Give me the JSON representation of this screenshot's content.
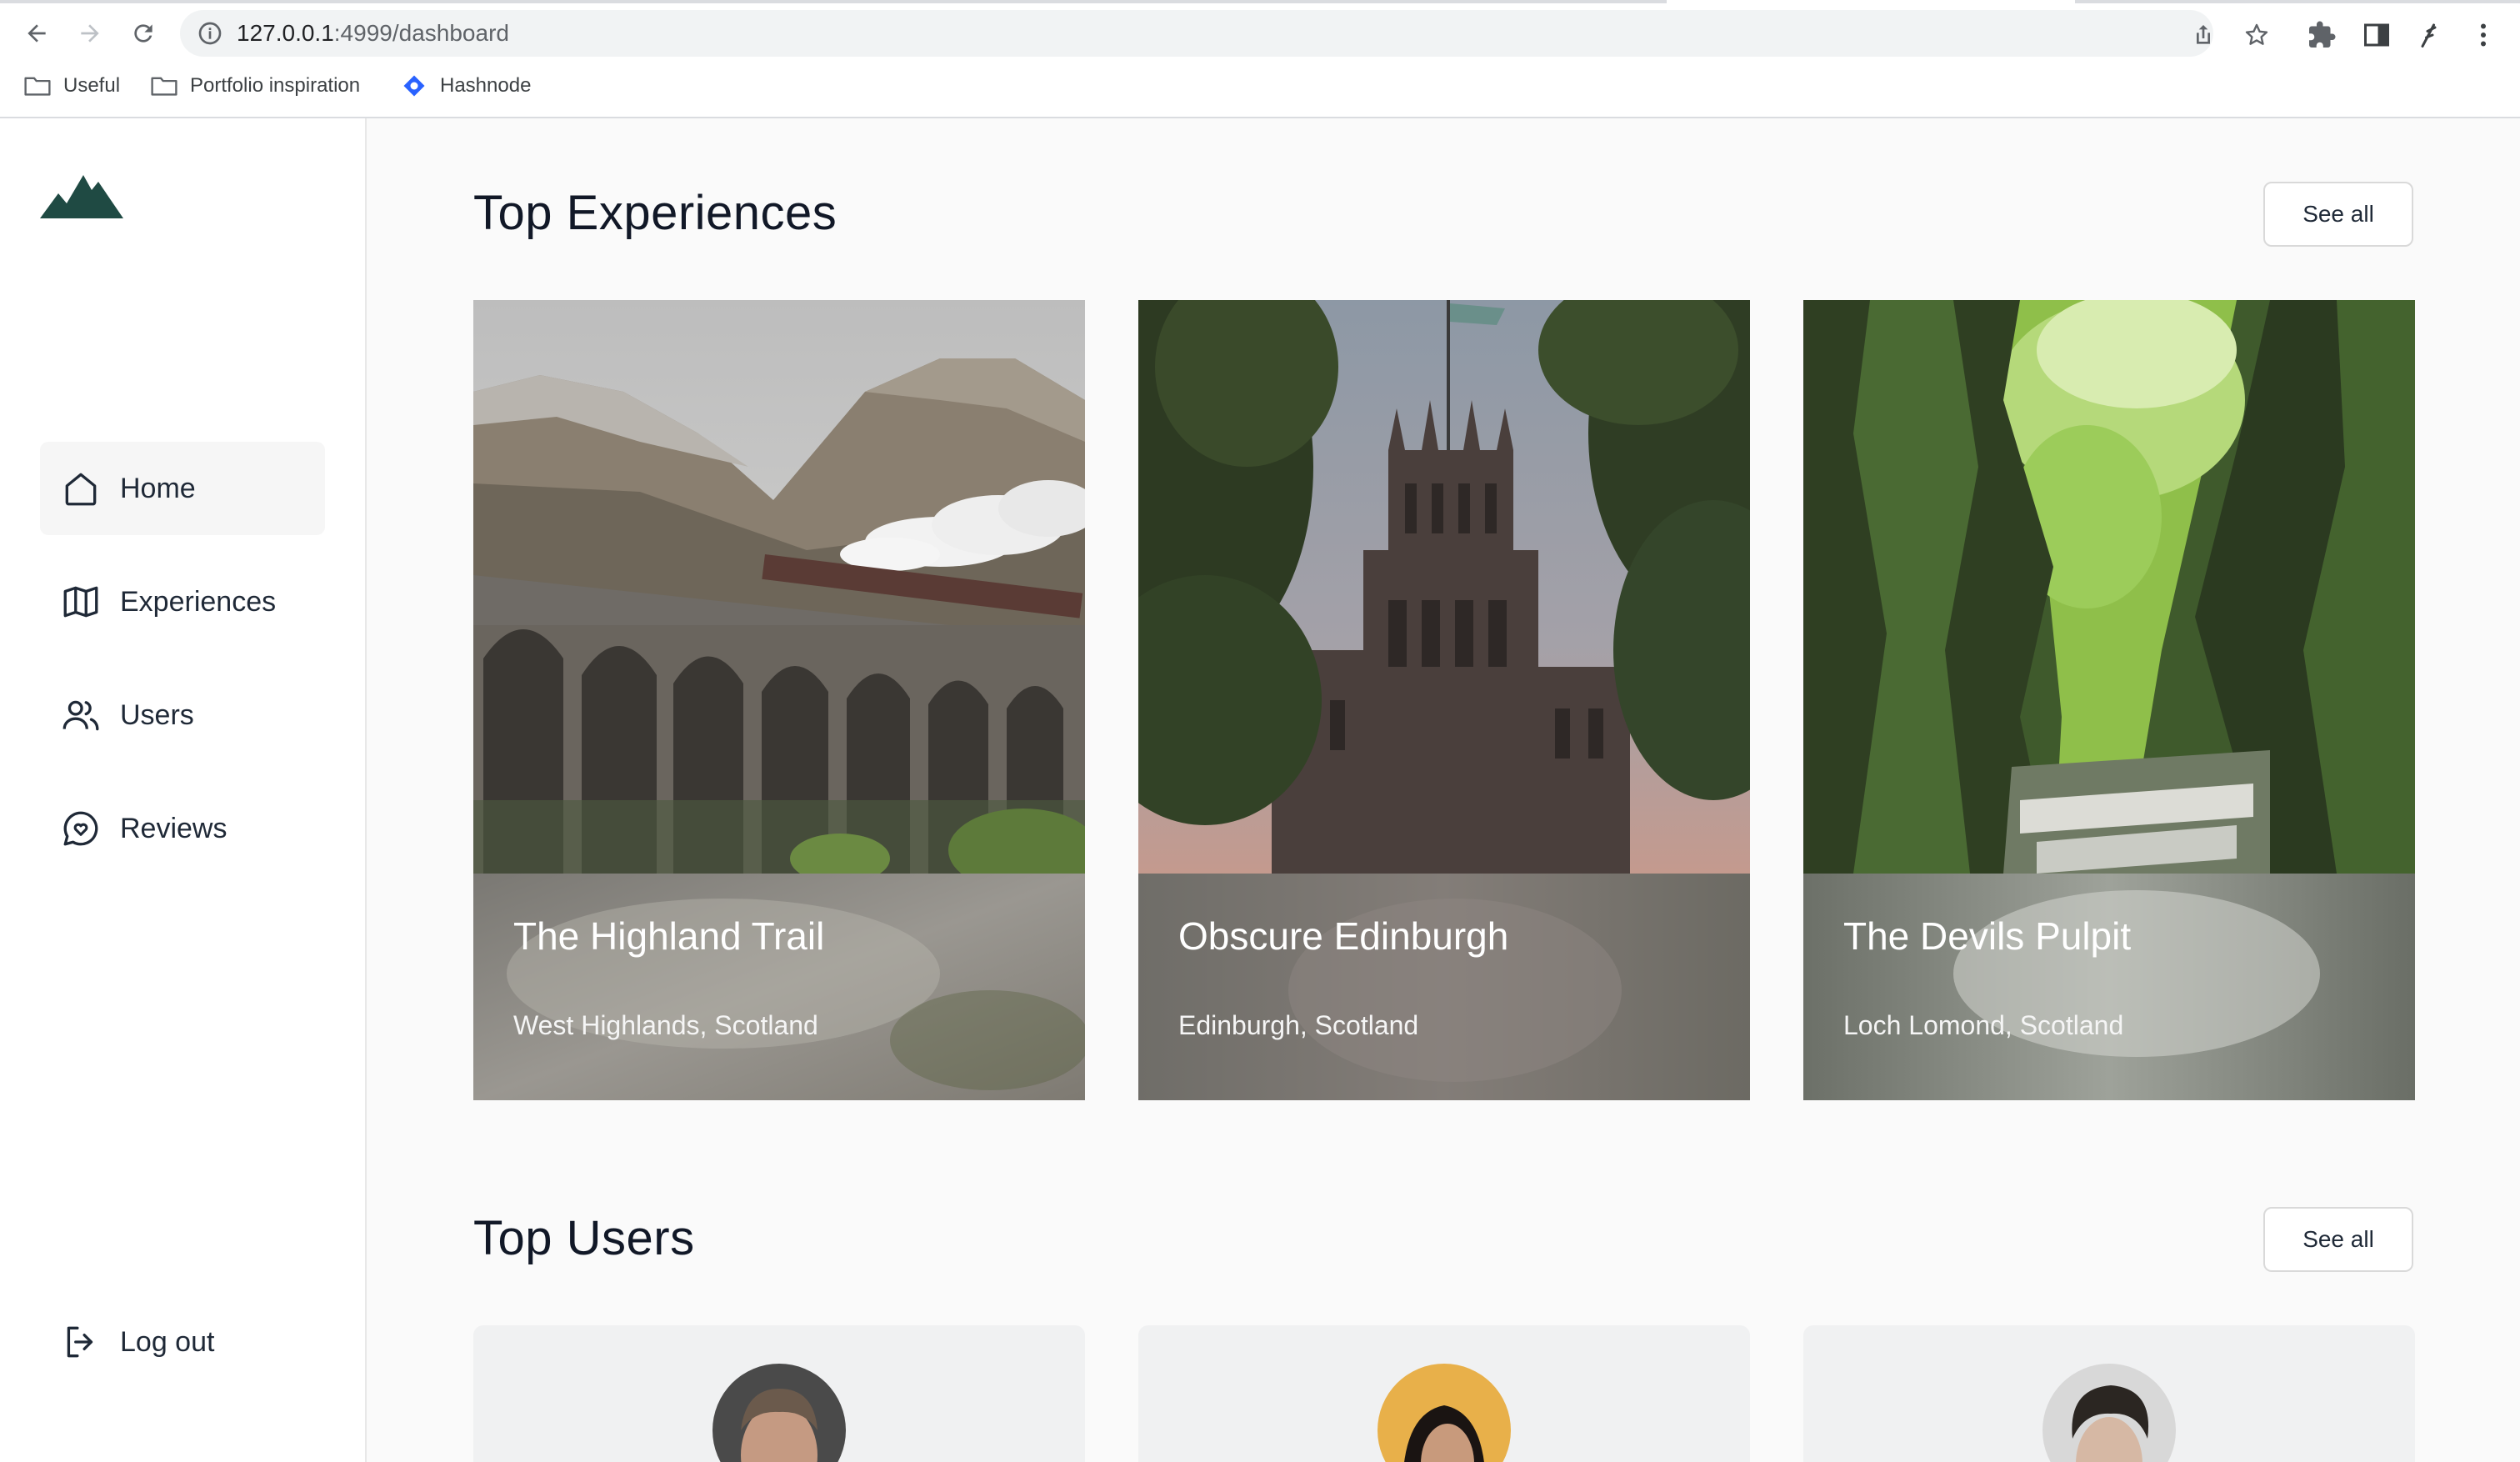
{
  "browser": {
    "url_host": "127.0.0.1",
    "url_path": ":4999/dashboard",
    "bookmarks": [
      {
        "label": "Useful",
        "icon": "folder-icon"
      },
      {
        "label": "Portfolio inspiration",
        "icon": "folder-icon"
      },
      {
        "label": "Hashnode",
        "icon": "hashnode-icon"
      }
    ]
  },
  "sidebar": {
    "logo": "mountain-logo",
    "items": [
      {
        "label": "Home",
        "icon": "home-icon",
        "active": true
      },
      {
        "label": "Experiences",
        "icon": "map-icon",
        "active": false
      },
      {
        "label": "Users",
        "icon": "users-icon",
        "active": false
      },
      {
        "label": "Reviews",
        "icon": "reviews-icon",
        "active": false
      }
    ],
    "logout_label": "Log out"
  },
  "experiences": {
    "title": "Top Experiences",
    "see_all_label": "See all",
    "cards": [
      {
        "title": "The Highland Trail",
        "location": "West Highlands, Scotland"
      },
      {
        "title": "Obscure Edinburgh",
        "location": "Edinburgh, Scotland"
      },
      {
        "title": "The Devils Pulpit",
        "location": "Loch Lomond, Scotland"
      }
    ]
  },
  "users": {
    "title": "Top Users",
    "see_all_label": "See all"
  },
  "colors": {
    "brand_dark_green": "#1f4a43",
    "active_nav_bg": "#f6f6f6",
    "page_bg": "#fafafa"
  }
}
